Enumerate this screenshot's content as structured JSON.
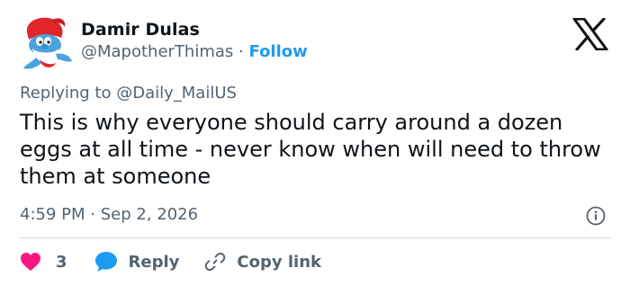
{
  "author": {
    "display_name": "Damir Dulas",
    "handle": "@MapotherThimas",
    "separator": "·",
    "follow_label": "Follow",
    "avatar_icon": "smurf-avatar-icon"
  },
  "platform_logo": "x-logo-icon",
  "reply_context": {
    "prefix": "Replying to",
    "target": "@Daily_MailUS"
  },
  "tweet": {
    "text": "This is why everyone should carry around a dozen eggs at all time - never know when will need to throw them at someone",
    "timestamp": "4:59 PM · Sep 2, 2026"
  },
  "actions": {
    "like_count": "3",
    "reply_label": "Reply",
    "copy_link_label": "Copy link"
  },
  "colors": {
    "accent": "#1d9bf0",
    "like": "#f91880",
    "muted_text": "#536471",
    "primary_text": "#0f1419",
    "divider": "#cfd9de"
  }
}
